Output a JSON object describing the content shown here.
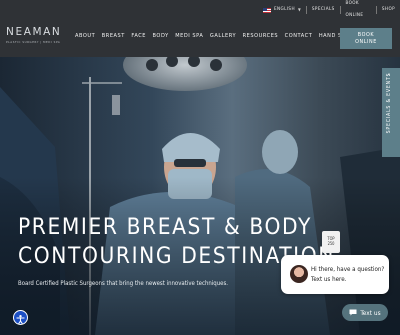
{
  "topbar": {
    "language": "ENGLISH",
    "links": [
      "SPECIALS",
      "BOOK ONLINE",
      "SHOP"
    ]
  },
  "logo": {
    "name": "NEAMAN",
    "tagline": "PLASTIC SURGERY | MEDI SPA"
  },
  "nav": {
    "items": [
      "ABOUT",
      "BREAST",
      "FACE",
      "BODY",
      "MEDI SPA",
      "GALLERY",
      "RESOURCES",
      "CONTACT",
      "HAND SURGERY"
    ]
  },
  "book_button": {
    "line1": "BOOK",
    "line2": "ONLINE"
  },
  "side_tab": {
    "label": "SPECIALS & EVENTS"
  },
  "hero": {
    "headline_line1": "PREMIER BREAST & BODY",
    "headline_line2": "CONTOURING DESTINATION",
    "subline": "Board Certified Plastic Surgeons that bring the newest innovative techniques."
  },
  "badge": {
    "line1": "TOP",
    "line2": "250"
  },
  "chat": {
    "message": "Hi there, have a question? Text us here.",
    "button_label": "Text us"
  },
  "colors": {
    "header_bg": "#2f3236",
    "accent": "#5d7f8a",
    "chat_button": "#55737d",
    "accessibility": "#1c4fc4"
  }
}
